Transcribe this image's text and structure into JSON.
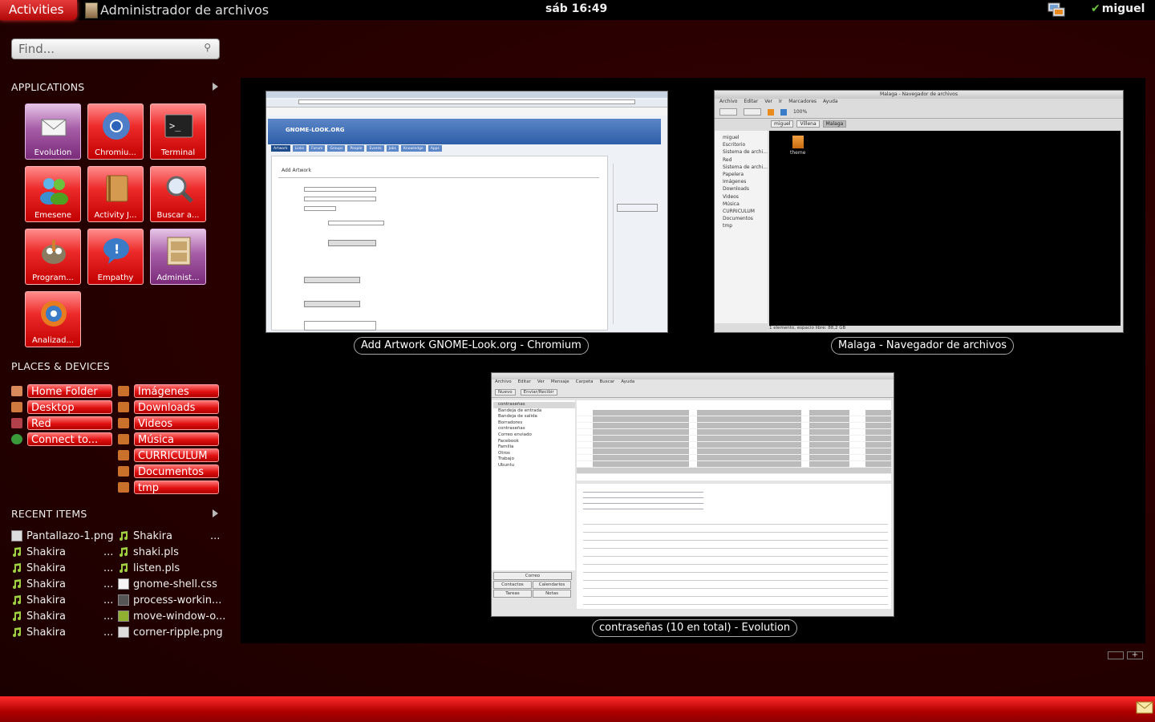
{
  "topbar": {
    "activities": "Activities",
    "app_title": "Administrador de archivos",
    "clock": "sáb 16:49",
    "user": "miguel"
  },
  "search": {
    "placeholder": "Find..."
  },
  "sections": {
    "applications": "APPLICATIONS",
    "places": "PLACES & DEVICES",
    "recent": "RECENT ITEMS"
  },
  "apps": [
    {
      "label": "Evolution",
      "icon": "envelope-icon"
    },
    {
      "label": "Chromiu...",
      "icon": "chromium-icon"
    },
    {
      "label": "Terminal",
      "icon": "terminal-icon"
    },
    {
      "label": "Emesene",
      "icon": "people-icon"
    },
    {
      "label": "Activity J...",
      "icon": "journal-icon"
    },
    {
      "label": "Buscar a...",
      "icon": "magnifier-icon"
    },
    {
      "label": "Program...",
      "icon": "gimp-icon"
    },
    {
      "label": "Empathy",
      "icon": "speech-bubble-icon"
    },
    {
      "label": "Administ...",
      "icon": "file-cabinet-icon"
    },
    {
      "label": "Analizad...",
      "icon": "disk-analyzer-icon"
    }
  ],
  "places": {
    "left": [
      "Home Folder",
      "Desktop",
      "Red",
      "Connect to..."
    ],
    "right": [
      "Imágenes",
      "Downloads",
      "Videos",
      "Música",
      "CURRICULUM",
      "Documentos",
      "tmp"
    ]
  },
  "recent": {
    "left": [
      "Pantallazo-1.png",
      "Shakira",
      "Shakira",
      "Shakira",
      "Shakira",
      "Shakira",
      "Shakira"
    ],
    "right": [
      "Shakira",
      "shaki.pls",
      "listen.pls",
      "gnome-shell.css",
      "process-workin...",
      "move-window-o...",
      "corner-ripple.png"
    ],
    "ellipsis": "..."
  },
  "windows": [
    {
      "title": "Add  Artwork GNOME-Look.org - Chromium"
    },
    {
      "title": "Malaga - Navegador de archivos"
    },
    {
      "title": "contraseñas (10 en total) - Evolution"
    }
  ],
  "window_content": {
    "chromium": {
      "site": "GNOME-LOOK.ORG",
      "tabs": [
        "Artwork",
        "Links",
        "Forum",
        "Groups",
        "People",
        "Events",
        "Jobs",
        "Knowledge",
        "Apps"
      ],
      "heading": "Add Artwork"
    },
    "nautilus": {
      "tab_title": "Malaga - Navegador de archivos",
      "menu": [
        "Archivo",
        "Editar",
        "Ver",
        "Ir",
        "Marcadores",
        "Ayuda"
      ],
      "sidebar": [
        "miguel",
        "Escritorio",
        "Sistema de archi...",
        "Red",
        "Sistema de archi...",
        "Papelera",
        "Imágenes",
        "Downloads",
        "Videos",
        "Música",
        "CURRICULUM",
        "Documentos",
        "tmp"
      ],
      "path": [
        "miguel",
        "Villena",
        "Malaga"
      ],
      "zoom": "100%",
      "folder": "theme",
      "status": "1 elemento, espacio libre: 88,2 GB"
    },
    "evolution": {
      "menu": [
        "Archivo",
        "Editar",
        "Ver",
        "Mensaje",
        "Carpeta",
        "Buscar",
        "Ayuda"
      ],
      "toolbar": [
        "Nuevo",
        "Enviar/Recibir"
      ],
      "folders": [
        "contraseñas",
        "Bandeja de entrada",
        "Bandeja de salida",
        "Borradores",
        "contraseñas",
        "Correo enviado",
        "Facebook",
        "Familia",
        "Otros",
        "Trabajo",
        "Ubuntu"
      ],
      "bottom_buttons": [
        "Correo",
        "Contactos",
        "Calendarios",
        "Tareas",
        "Notas"
      ]
    }
  },
  "colors": {
    "accent_red": "#e01010",
    "tile_purple": "#a65da6",
    "background": "#2a0000"
  }
}
